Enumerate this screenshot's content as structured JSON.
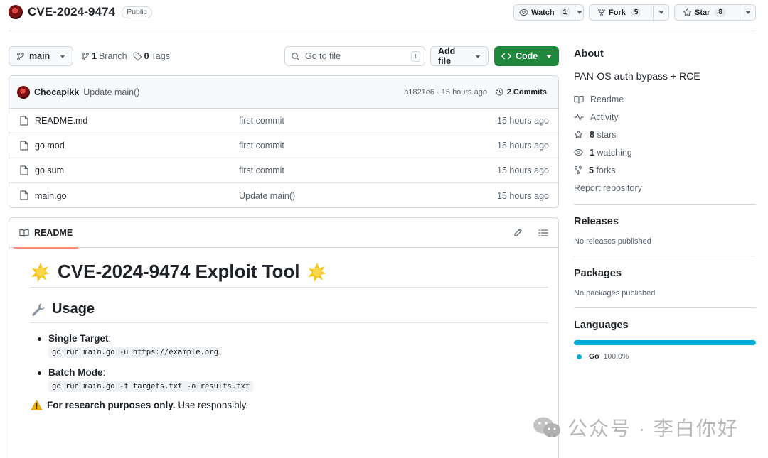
{
  "repo": {
    "name": "CVE-2024-9474",
    "visibility": "Public"
  },
  "header": {
    "watch_label": "Watch",
    "watch_count": "1",
    "fork_label": "Fork",
    "fork_count": "5",
    "star_label": "Star",
    "star_count": "8"
  },
  "toolbar": {
    "branch_name": "main",
    "branch_count": "1",
    "branch_label": "Branch",
    "tags_count": "0",
    "tags_label": "Tags",
    "goto_placeholder": "Go to file",
    "goto_shortcut": "t",
    "add_file_label": "Add file",
    "code_label": "Code"
  },
  "commit": {
    "author": "Chocapikk",
    "message": "Update main()",
    "hash_time": "b1821e6 · 15 hours ago",
    "count_label": "2 Commits"
  },
  "files": [
    {
      "name": "README.md",
      "message": "first commit",
      "time": "15 hours ago"
    },
    {
      "name": "go.mod",
      "message": "first commit",
      "time": "15 hours ago"
    },
    {
      "name": "go.sum",
      "message": "first commit",
      "time": "15 hours ago"
    },
    {
      "name": "main.go",
      "message": "Update main()",
      "time": "15 hours ago"
    }
  ],
  "readme": {
    "tab_label": "README",
    "title": "CVE-2024-9474 Exploit Tool",
    "usage_heading": "Usage",
    "single_label": "Single Target",
    "single_cmd": "go run main.go -u https://example.org",
    "batch_label": "Batch Mode",
    "batch_cmd": "go run main.go -f targets.txt -o results.txt",
    "note_bold": "For research purposes only.",
    "note_rest": " Use responsibly."
  },
  "sidebar": {
    "about_heading": "About",
    "description": "PAN-OS auth bypass + RCE",
    "readme_link": "Readme",
    "activity_link": "Activity",
    "stars_count": "8",
    "stars_label": "stars",
    "watching_count": "1",
    "watching_label": "watching",
    "forks_count": "5",
    "forks_label": "forks",
    "report_link": "Report repository",
    "releases_heading": "Releases",
    "releases_empty": "No releases published",
    "packages_heading": "Packages",
    "packages_empty": "No packages published",
    "languages_heading": "Languages",
    "language_name": "Go",
    "language_pct": "100.0%",
    "language_share": 1.0,
    "language_color": "#00add8"
  },
  "watermark": {
    "text": "公众号 · 李白你好"
  },
  "colors": {
    "accent_green": "#1f883d",
    "tab_underline": "#fd8c73"
  }
}
